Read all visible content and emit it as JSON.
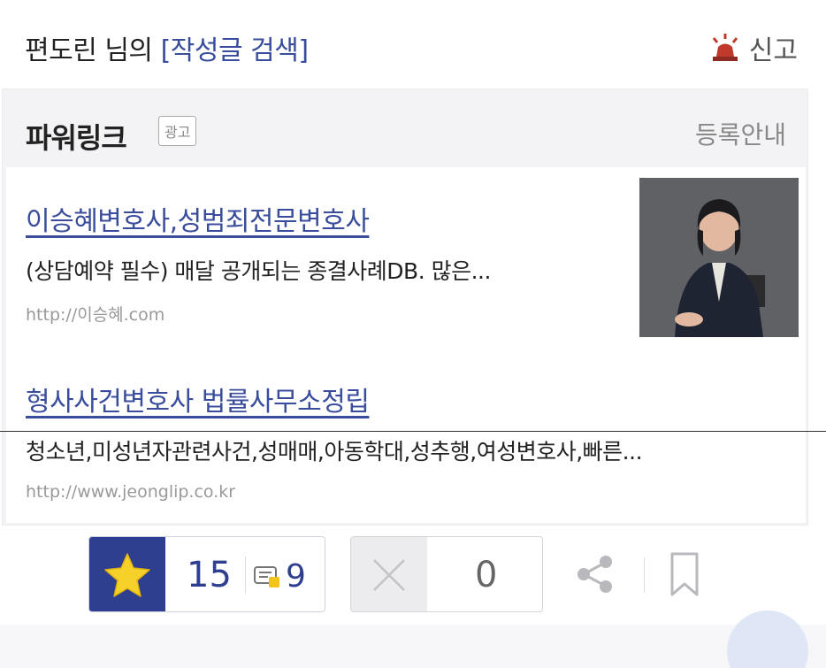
{
  "header": {
    "author_prefix": "편도린 님의 ",
    "search_link": "[작성글 검색]",
    "report_label": "신고"
  },
  "powerlink": {
    "title": "파워링크",
    "ad_badge": "광고",
    "register_label": "등록안내",
    "ads": [
      {
        "title": "이승혜변호사,성범죄전문변호사",
        "description": "(상담예약 필수) 매달 공개되는 종결사례DB. 많은...",
        "url": "http://이승혜.com"
      },
      {
        "title": "형사사건변호사 법률사무소정립",
        "description": "청소년,미성년자관련사건,성매매,아동학대,성추행,여성변호사,빠른...",
        "url": "http://www.jeonglip.co.kr"
      }
    ]
  },
  "actions": {
    "like_count": "15",
    "comment_count": "9",
    "dislike_count": "0"
  },
  "colors": {
    "accent": "#2f3f8f",
    "link": "#3a4d9c",
    "star": "#f6d12a",
    "siren": "#c0392b"
  },
  "icons": [
    "siren-icon",
    "star-icon",
    "comment-icon",
    "close-icon",
    "share-icon",
    "bookmark-icon"
  ]
}
